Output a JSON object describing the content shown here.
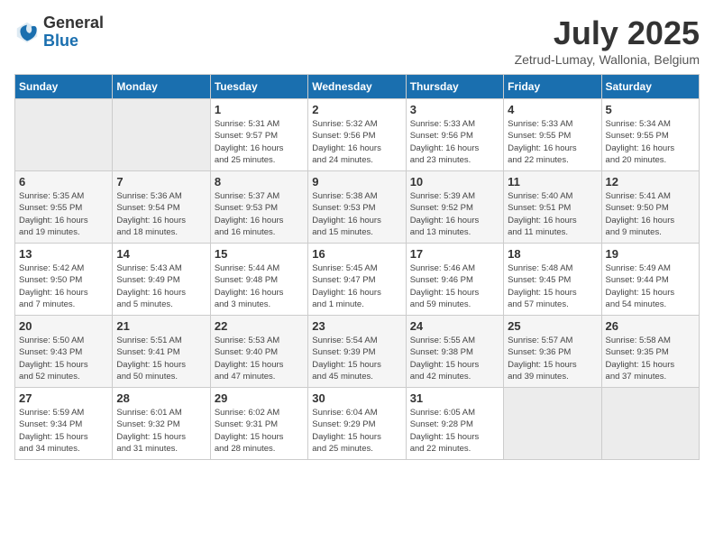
{
  "logo": {
    "general": "General",
    "blue": "Blue"
  },
  "title": "July 2025",
  "location": "Zetrud-Lumay, Wallonia, Belgium",
  "days_of_week": [
    "Sunday",
    "Monday",
    "Tuesday",
    "Wednesday",
    "Thursday",
    "Friday",
    "Saturday"
  ],
  "weeks": [
    [
      {
        "day": "",
        "detail": ""
      },
      {
        "day": "",
        "detail": ""
      },
      {
        "day": "1",
        "detail": "Sunrise: 5:31 AM\nSunset: 9:57 PM\nDaylight: 16 hours\nand 25 minutes."
      },
      {
        "day": "2",
        "detail": "Sunrise: 5:32 AM\nSunset: 9:56 PM\nDaylight: 16 hours\nand 24 minutes."
      },
      {
        "day": "3",
        "detail": "Sunrise: 5:33 AM\nSunset: 9:56 PM\nDaylight: 16 hours\nand 23 minutes."
      },
      {
        "day": "4",
        "detail": "Sunrise: 5:33 AM\nSunset: 9:55 PM\nDaylight: 16 hours\nand 22 minutes."
      },
      {
        "day": "5",
        "detail": "Sunrise: 5:34 AM\nSunset: 9:55 PM\nDaylight: 16 hours\nand 20 minutes."
      }
    ],
    [
      {
        "day": "6",
        "detail": "Sunrise: 5:35 AM\nSunset: 9:55 PM\nDaylight: 16 hours\nand 19 minutes."
      },
      {
        "day": "7",
        "detail": "Sunrise: 5:36 AM\nSunset: 9:54 PM\nDaylight: 16 hours\nand 18 minutes."
      },
      {
        "day": "8",
        "detail": "Sunrise: 5:37 AM\nSunset: 9:53 PM\nDaylight: 16 hours\nand 16 minutes."
      },
      {
        "day": "9",
        "detail": "Sunrise: 5:38 AM\nSunset: 9:53 PM\nDaylight: 16 hours\nand 15 minutes."
      },
      {
        "day": "10",
        "detail": "Sunrise: 5:39 AM\nSunset: 9:52 PM\nDaylight: 16 hours\nand 13 minutes."
      },
      {
        "day": "11",
        "detail": "Sunrise: 5:40 AM\nSunset: 9:51 PM\nDaylight: 16 hours\nand 11 minutes."
      },
      {
        "day": "12",
        "detail": "Sunrise: 5:41 AM\nSunset: 9:50 PM\nDaylight: 16 hours\nand 9 minutes."
      }
    ],
    [
      {
        "day": "13",
        "detail": "Sunrise: 5:42 AM\nSunset: 9:50 PM\nDaylight: 16 hours\nand 7 minutes."
      },
      {
        "day": "14",
        "detail": "Sunrise: 5:43 AM\nSunset: 9:49 PM\nDaylight: 16 hours\nand 5 minutes."
      },
      {
        "day": "15",
        "detail": "Sunrise: 5:44 AM\nSunset: 9:48 PM\nDaylight: 16 hours\nand 3 minutes."
      },
      {
        "day": "16",
        "detail": "Sunrise: 5:45 AM\nSunset: 9:47 PM\nDaylight: 16 hours\nand 1 minute."
      },
      {
        "day": "17",
        "detail": "Sunrise: 5:46 AM\nSunset: 9:46 PM\nDaylight: 15 hours\nand 59 minutes."
      },
      {
        "day": "18",
        "detail": "Sunrise: 5:48 AM\nSunset: 9:45 PM\nDaylight: 15 hours\nand 57 minutes."
      },
      {
        "day": "19",
        "detail": "Sunrise: 5:49 AM\nSunset: 9:44 PM\nDaylight: 15 hours\nand 54 minutes."
      }
    ],
    [
      {
        "day": "20",
        "detail": "Sunrise: 5:50 AM\nSunset: 9:43 PM\nDaylight: 15 hours\nand 52 minutes."
      },
      {
        "day": "21",
        "detail": "Sunrise: 5:51 AM\nSunset: 9:41 PM\nDaylight: 15 hours\nand 50 minutes."
      },
      {
        "day": "22",
        "detail": "Sunrise: 5:53 AM\nSunset: 9:40 PM\nDaylight: 15 hours\nand 47 minutes."
      },
      {
        "day": "23",
        "detail": "Sunrise: 5:54 AM\nSunset: 9:39 PM\nDaylight: 15 hours\nand 45 minutes."
      },
      {
        "day": "24",
        "detail": "Sunrise: 5:55 AM\nSunset: 9:38 PM\nDaylight: 15 hours\nand 42 minutes."
      },
      {
        "day": "25",
        "detail": "Sunrise: 5:57 AM\nSunset: 9:36 PM\nDaylight: 15 hours\nand 39 minutes."
      },
      {
        "day": "26",
        "detail": "Sunrise: 5:58 AM\nSunset: 9:35 PM\nDaylight: 15 hours\nand 37 minutes."
      }
    ],
    [
      {
        "day": "27",
        "detail": "Sunrise: 5:59 AM\nSunset: 9:34 PM\nDaylight: 15 hours\nand 34 minutes."
      },
      {
        "day": "28",
        "detail": "Sunrise: 6:01 AM\nSunset: 9:32 PM\nDaylight: 15 hours\nand 31 minutes."
      },
      {
        "day": "29",
        "detail": "Sunrise: 6:02 AM\nSunset: 9:31 PM\nDaylight: 15 hours\nand 28 minutes."
      },
      {
        "day": "30",
        "detail": "Sunrise: 6:04 AM\nSunset: 9:29 PM\nDaylight: 15 hours\nand 25 minutes."
      },
      {
        "day": "31",
        "detail": "Sunrise: 6:05 AM\nSunset: 9:28 PM\nDaylight: 15 hours\nand 22 minutes."
      },
      {
        "day": "",
        "detail": ""
      },
      {
        "day": "",
        "detail": ""
      }
    ]
  ]
}
